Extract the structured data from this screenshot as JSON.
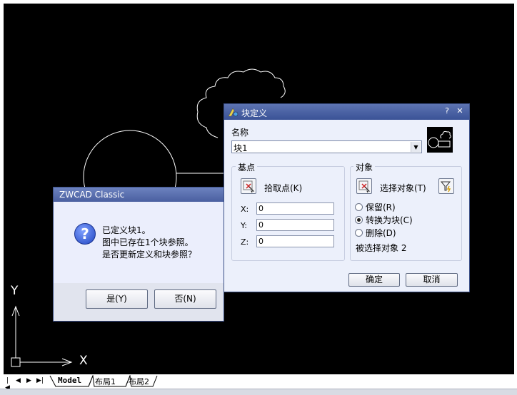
{
  "canvas": {
    "ucs_x_label": "X",
    "ucs_y_label": "Y"
  },
  "block_dialog": {
    "title": "块定义",
    "help_label": "?",
    "close_label": "✕",
    "name_label": "名称",
    "name_value": "块1",
    "base_point": {
      "group_title": "基点",
      "pick_label": "拾取点(K)",
      "x_label": "X:",
      "x_value": "0",
      "y_label": "Y:",
      "y_value": "0",
      "z_label": "Z:",
      "z_value": "0"
    },
    "objects": {
      "group_title": "对象",
      "select_label": "选择对象(T)",
      "options": [
        {
          "label": "保留(R)",
          "selected": false
        },
        {
          "label": "转换为块(C)",
          "selected": true
        },
        {
          "label": "删除(D)",
          "selected": false
        }
      ],
      "selected_count_text": "被选择对象 2"
    },
    "ok_label": "确定",
    "cancel_label": "取消"
  },
  "message_box": {
    "title": "ZWCAD Classic",
    "icon": "question-icon",
    "lines": [
      "已定义块1。",
      "图中已存在1个块参照。",
      "是否更新定义和块参照？"
    ],
    "yes_label": "是(Y)",
    "no_label": "否(N)"
  },
  "layout_tabs": {
    "tabs": [
      "Model",
      "布局1",
      "布局2"
    ],
    "active": "Model"
  },
  "colors": {
    "canvas_bg": "#000000",
    "dialog_title": "#3a5296",
    "dialog_bg": "#ecf0fb"
  }
}
